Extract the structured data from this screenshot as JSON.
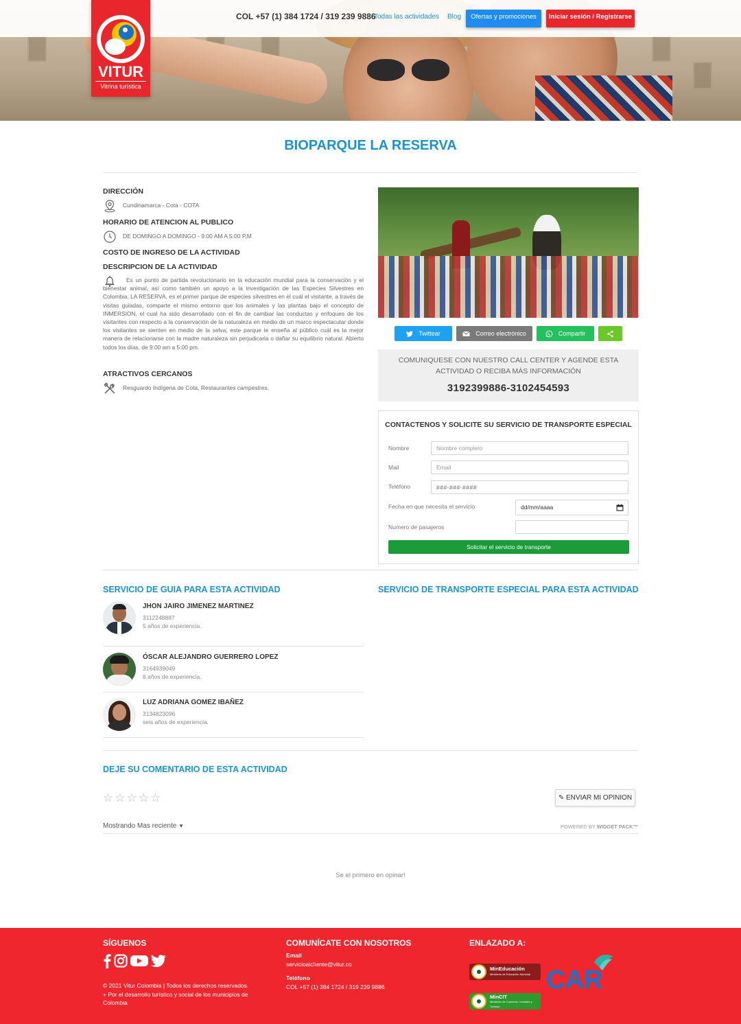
{
  "header": {
    "brand": "VITUR",
    "tagline": "Vitrina turística",
    "phone": "COL +57 (1) 384 1724 / 319 239 9886",
    "nav": {
      "all_activities": "Todas las actividades",
      "blog": "Blog",
      "offers": "Ofertas y promociones",
      "login": "Iniciar sesión / Registrarse"
    }
  },
  "activity": {
    "title": "BIOPARQUE LA RESERVA",
    "address_heading": "DIRECCIÓN",
    "address": "Cundinamarca - Cota - COTA",
    "hours_heading": "HORARIO DE ATENCION AL PUBLICO",
    "hours": "DE DOMINGO A DOMINGO - 9:00 AM A 5:00 P,M",
    "cost_heading": "COSTO DE INGRESO DE LA ACTIVIDAD",
    "description_heading": "DESCRIPCION DE LA ACTIVIDAD",
    "description": "Es un punto de partida revolucionario en la educación mundial para la conservación y el bienestar animal, así como también un apoyo a la investigación de las Especies Silvestres en Colombia. LA RESERVA, es el primer parque de especies silvestres en el cuál el visitante, a través de visitas guiadas, comparte el mismo entorno que los animales y las plantas bajo el concepto de INMERSION, el cual ha sido desarrollado con el fin de cambiar las conductas y enfoques de los visitantes con respecto a la conservación de la naturaleza en medio de un marco espectacular donde los visitantes se sienten en medio de la selva; este parque le enseña al público cuál es la mejor manera de relacionarse con la madre naturaleza sin perjudicarla o dañar su equilibrio natural. Abierto todos los días, de 9:00 am a 5:00 pm.",
    "nearby_heading": "ATRACTIVOS CERCANOS",
    "nearby": "Resguardo Indígena de Cota, Restaurantes campestres,"
  },
  "share": {
    "twitter": "Twittear",
    "email": "Correo electrónico",
    "whatsapp": "Compartir"
  },
  "callcenter": {
    "text": "COMUNIQUESE CON NUESTRO CALL CENTER Y AGENDE ESTA ACTIVIDAD O RECIBA MÁS INFORMACIÓN",
    "phones": "3192399886-3102454593"
  },
  "form": {
    "title": "CONTACTENOS Y SOLICITE SU SERVICIO DE TRANSPORTE ESPECIAL",
    "name_label": "Nombre",
    "name_placeholder": "Nombre completo",
    "mail_label": "Mail",
    "mail_placeholder": "Email",
    "phone_label": "Teléfono",
    "phone_placeholder": "###-###-####",
    "date_label": "Fecha en que necesita el servicio",
    "date_placeholder": "dd/mm/aaaa",
    "passengers_label": "Numero de pasajeros",
    "submit": "Solicitar el servicio de transporte"
  },
  "guides": {
    "title": "SERVICIO DE GUIA PARA ESTA ACTIVIDAD",
    "items": [
      {
        "name": "JHON JAIRO JIMENEZ MARTINEZ",
        "phone": "3112248887",
        "experience": "5 años de experiencia."
      },
      {
        "name": "ÓSCAR ALEJANDRO GUERRERO LOPEZ",
        "phone": "3164939049",
        "experience": "8 años de experiencia."
      },
      {
        "name": "LUZ ADRIANA GOMEZ IBAÑEZ",
        "phone": "3134823096",
        "experience": "seis años de experiencia."
      }
    ]
  },
  "transport": {
    "title": "SERVICIO DE TRANSPORTE ESPECIAL PARA ESTA ACTIVIDAD"
  },
  "comments": {
    "title": "DEJE SU COMENTARIO DE ESTA ACTIVIDAD",
    "rating": 0,
    "max_rating": 5,
    "opinion_button": "ENVIAR MI OPINION",
    "sort_prefix": "Mostrando",
    "sort_value": "Mas reciente",
    "powered": "POWERED BY",
    "powered_brand": "WIDGET PACK™",
    "empty": "Se el primero en opinar!"
  },
  "footer": {
    "follow_heading": "SÍGUENOS",
    "copyright": "© 2021 Vitur Colombia | Todos los derechos reservados.",
    "mission": "+ Por el desarrollo turístico y social de los municipios de Colombia",
    "contact_heading": "COMUNÍCATE CON NOSOTROS",
    "email_label": "Email",
    "email": "servicioalcliente@vitur.co",
    "phone_label": "Teléfono",
    "phone": "COL +57 (1) 384 1724 / 319 239 9886",
    "linked_heading": "ENLAZADO A:",
    "partner1": "MinEducación",
    "partner1_sub": "Ministerio de Educación Nacional",
    "partner2": "MinCIT",
    "partner2_sub": "Ministerio de Comercio, Industria y Turismo",
    "partner3": "CAR"
  },
  "colors": {
    "accent": "#1a93d1",
    "brand_red": "#e9262c",
    "footer_red": "#f0262e",
    "green": "#1c9b3a",
    "twitter": "#1da1f2"
  }
}
